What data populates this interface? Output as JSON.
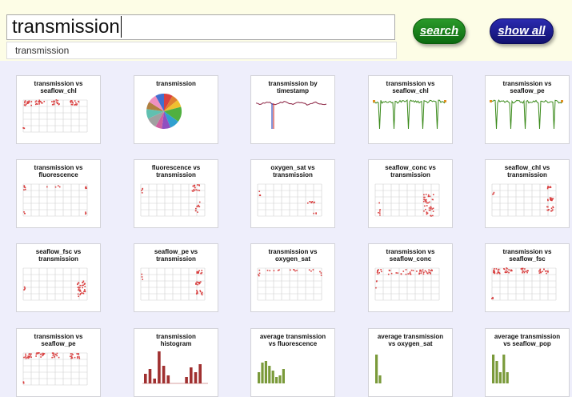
{
  "search": {
    "query": "transmission",
    "suggestion": "transmission"
  },
  "buttons": {
    "search": "search",
    "show_all": "show all"
  },
  "colors": {
    "topbar": "#fdfde6",
    "background": "#eeeefb",
    "scatter": "#d94040",
    "line_series": "#3a8a1a",
    "hist_bars": "#a03030",
    "avg_bars": "#7a9a3a"
  },
  "thumbnails": [
    {
      "title_lines": [
        "transmission vs",
        "seaflow_chl"
      ],
      "kind": "scatter",
      "variant": "top-clusters"
    },
    {
      "title_lines": [
        "transmission",
        ""
      ],
      "kind": "pie",
      "variant": "pie"
    },
    {
      "title_lines": [
        "transmission by",
        "timestamp"
      ],
      "kind": "line",
      "variant": "dip"
    },
    {
      "title_lines": [
        "transmission vs",
        "seaflow_chl"
      ],
      "kind": "line",
      "variant": "green-spikes"
    },
    {
      "title_lines": [
        "transmission vs",
        "seaflow_pe"
      ],
      "kind": "line",
      "variant": "green-spikes"
    },
    {
      "title_lines": [
        "transmission vs",
        "fluorescence"
      ],
      "kind": "scatter",
      "variant": "left-right-edges"
    },
    {
      "title_lines": [
        "fluorescence vs",
        "transmission"
      ],
      "kind": "scatter",
      "variant": "right-cluster"
    },
    {
      "title_lines": [
        "oxygen_sat vs",
        "transmission"
      ],
      "kind": "scatter",
      "variant": "right-sparse"
    },
    {
      "title_lines": [
        "seaflow_conc vs",
        "transmission"
      ],
      "kind": "scatter",
      "variant": "right-dense"
    },
    {
      "title_lines": [
        "seaflow_chl vs",
        "transmission"
      ],
      "kind": "scatter",
      "variant": "right-bands"
    },
    {
      "title_lines": [
        "seaflow_fsc vs",
        "transmission"
      ],
      "kind": "scatter",
      "variant": "right-blob"
    },
    {
      "title_lines": [
        "seaflow_pe vs",
        "transmission"
      ],
      "kind": "scatter",
      "variant": "right-bands"
    },
    {
      "title_lines": [
        "transmission vs",
        "oxygen_sat"
      ],
      "kind": "scatter",
      "variant": "top-row"
    },
    {
      "title_lines": [
        "transmission vs",
        "seaflow_conc"
      ],
      "kind": "scatter",
      "variant": "top-dense"
    },
    {
      "title_lines": [
        "transmission vs",
        "seaflow_fsc"
      ],
      "kind": "scatter",
      "variant": "top-clusters"
    },
    {
      "title_lines": [
        "transmission vs",
        "seaflow_pe"
      ],
      "kind": "scatter",
      "variant": "top-clusters"
    },
    {
      "title_lines": [
        "transmission",
        "histogram"
      ],
      "kind": "bars",
      "variant": "hist"
    },
    {
      "title_lines": [
        "average transmission",
        "vs fluorescence"
      ],
      "kind": "bars",
      "variant": "avg-fluor"
    },
    {
      "title_lines": [
        "average transmission",
        "vs oxygen_sat"
      ],
      "kind": "bars",
      "variant": "avg-oxy"
    },
    {
      "title_lines": [
        "average transmission",
        "vs seaflow_pop"
      ],
      "kind": "bars",
      "variant": "avg-pop"
    }
  ]
}
